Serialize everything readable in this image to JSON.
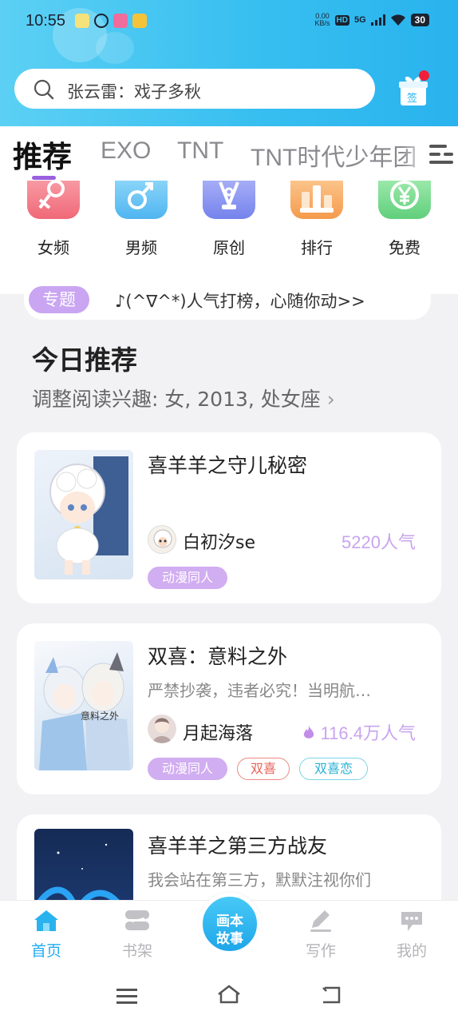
{
  "status_bar": {
    "time": "10:55",
    "net_speed_value": "0.00",
    "net_speed_unit": "KB/s",
    "hd": "HD",
    "signal": "5G",
    "battery": "30"
  },
  "search": {
    "text": "张云雷：戏子多秋"
  },
  "checkin": {
    "badge_text": "签"
  },
  "tabs": [
    {
      "label": "推荐",
      "active": true
    },
    {
      "label": "EXO"
    },
    {
      "label": "TNT"
    },
    {
      "label": "TNT时代少年团"
    }
  ],
  "categories": [
    {
      "label": "女频",
      "icon": "female-icon",
      "color": "#f27a86"
    },
    {
      "label": "男频",
      "icon": "male-icon",
      "color": "#5cbcf2"
    },
    {
      "label": "原创",
      "icon": "pen-nib-icon",
      "color": "#7f8cf0"
    },
    {
      "label": "排行",
      "icon": "podium-icon",
      "color": "#f7a45a"
    },
    {
      "label": "免费",
      "icon": "yen-icon",
      "color": "#6ed487"
    }
  ],
  "topic": {
    "badge": "专题",
    "text": "♪(^∇^*)人气打榜，心随你动>>"
  },
  "today": {
    "title": "今日推荐",
    "subtitle": "调整阅读兴趣: 女, 2013, 处女座"
  },
  "books": [
    {
      "title": "喜羊羊之守儿秘密",
      "description": "",
      "author": "白初汐se",
      "popularity": "5220人气",
      "hot": false,
      "tags": [
        {
          "label": "动漫同人",
          "style": "fill"
        }
      ]
    },
    {
      "title": "双喜：意料之外",
      "description": "严禁抄袭，违者必究！当明航…",
      "author": "月起海落",
      "popularity": "116.4万人气",
      "hot": true,
      "tags": [
        {
          "label": "动漫同人",
          "style": "fill"
        },
        {
          "label": "双喜",
          "style": "red"
        },
        {
          "label": "双喜恋",
          "style": "cyan"
        }
      ]
    },
    {
      "title": "喜羊羊之第三方战友",
      "description": "我会站在第三方，默默注视你们",
      "author": "",
      "popularity": "",
      "tags": []
    }
  ],
  "bottom_nav": {
    "items": [
      {
        "label": "首页",
        "active": true
      },
      {
        "label": "书架"
      },
      {
        "label": "写作"
      },
      {
        "label": "我的"
      }
    ],
    "center_line1": "画本",
    "center_line2": "故事"
  },
  "colors": {
    "accent_blue": "#24aef0",
    "accent_purple": "#9b5fe0",
    "popularity": "#c9a5ee"
  }
}
